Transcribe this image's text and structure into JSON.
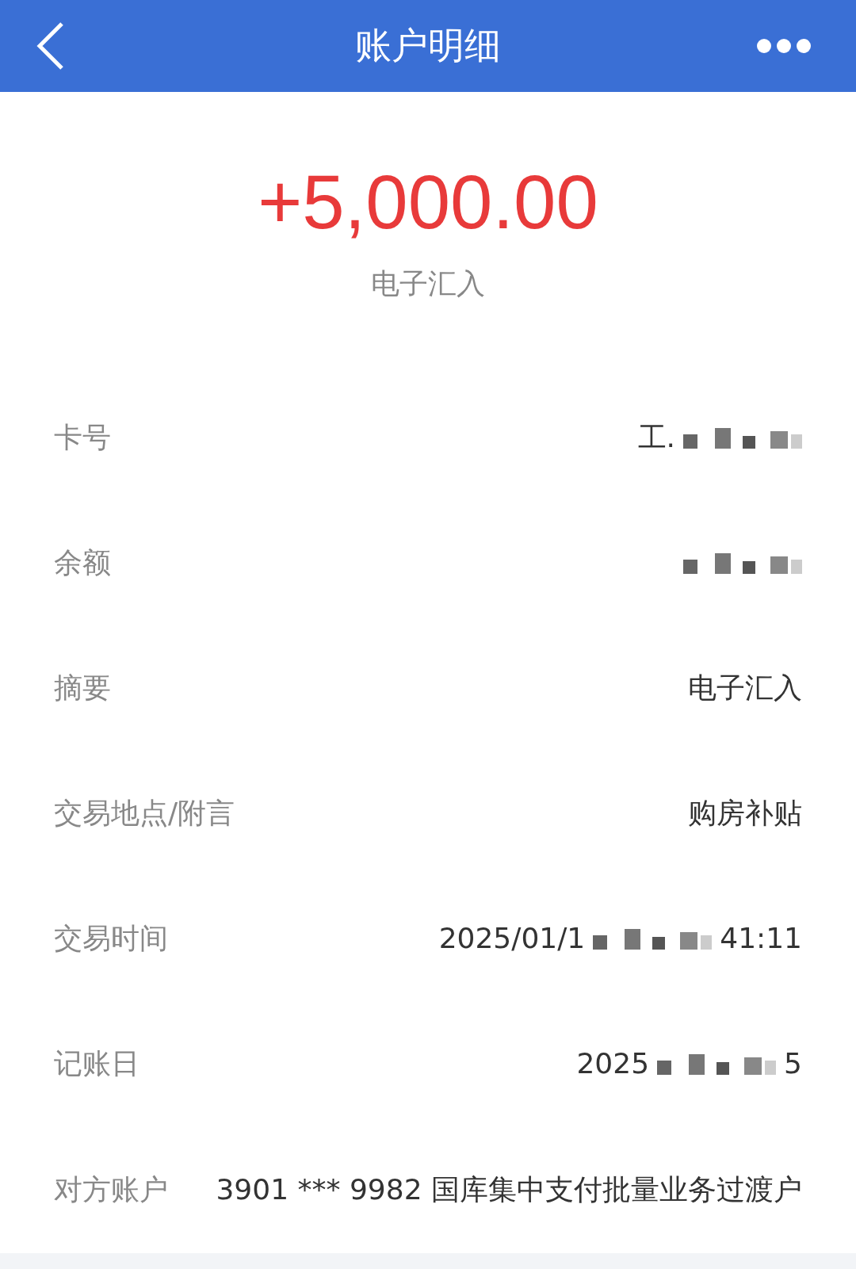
{
  "header": {
    "title": "账户明细"
  },
  "amount": "+5,000.00",
  "subtitle": "电子汇入",
  "rows": [
    {
      "label": "卡号",
      "parts": [
        {
          "kind": "text",
          "text": "工."
        },
        {
          "kind": "redacted"
        }
      ]
    },
    {
      "label": "余额",
      "parts": [
        {
          "kind": "redacted"
        }
      ]
    },
    {
      "label": "摘要",
      "parts": [
        {
          "kind": "text",
          "text": "电子汇入"
        }
      ]
    },
    {
      "label": "交易地点/附言",
      "parts": [
        {
          "kind": "text",
          "text": "购房补贴"
        }
      ]
    },
    {
      "label": "交易时间",
      "parts": [
        {
          "kind": "text",
          "text": "2025/01/1"
        },
        {
          "kind": "redacted"
        },
        {
          "kind": "text",
          "text": "41:11"
        }
      ]
    },
    {
      "label": "记账日",
      "parts": [
        {
          "kind": "text",
          "text": "2025"
        },
        {
          "kind": "redacted"
        },
        {
          "kind": "text",
          "text": "5"
        }
      ]
    },
    {
      "label": "对方账户",
      "parts": [
        {
          "kind": "text",
          "text": "3901 *** 9982 国库集中支付批量业务过渡户"
        }
      ]
    }
  ]
}
